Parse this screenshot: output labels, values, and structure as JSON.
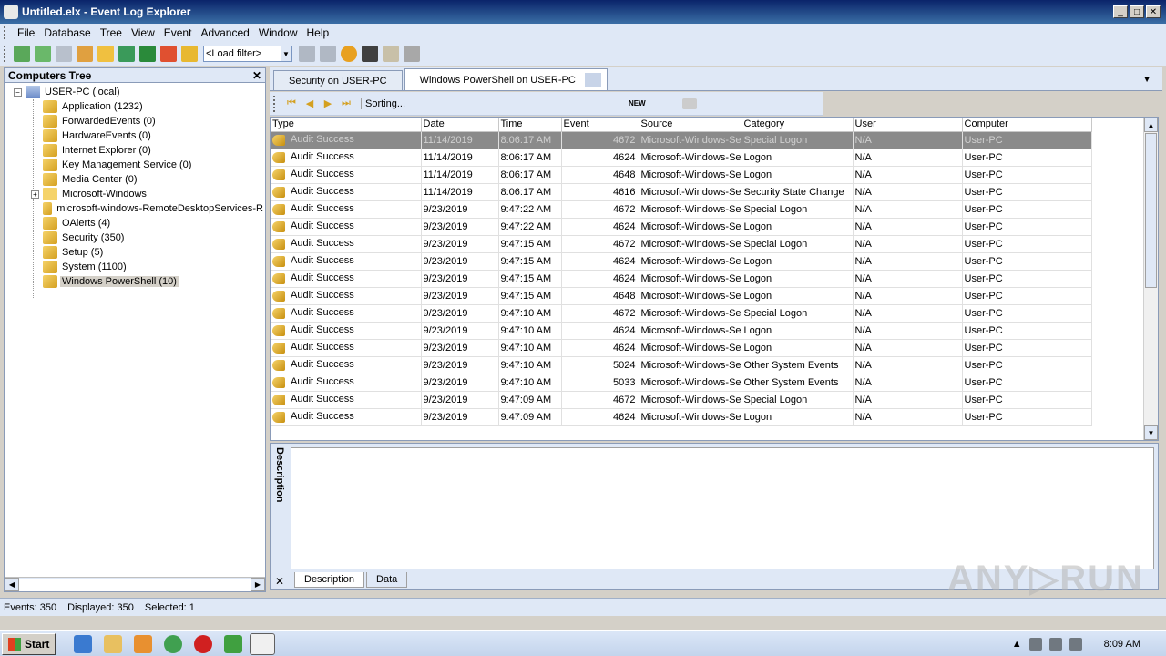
{
  "window": {
    "title": "Untitled.elx - Event Log Explorer",
    "minimize": "_",
    "maximize": "□",
    "close": "✕"
  },
  "menu": [
    "File",
    "Database",
    "Tree",
    "View",
    "Event",
    "Advanced",
    "Window",
    "Help"
  ],
  "toolbar": {
    "filter_value": "<Load filter>"
  },
  "computers_tree": {
    "title": "Computers Tree",
    "close": "✕",
    "root": "USER-PC (local)",
    "items": [
      "Application (1232)",
      "ForwardedEvents (0)",
      "HardwareEvents (0)",
      "Internet Explorer (0)",
      "Key Management Service (0)",
      "Media Center (0)",
      "Microsoft-Windows",
      "microsoft-windows-RemoteDesktopServices-R",
      "OAlerts (4)",
      "Security (350)",
      "Setup (5)",
      "System (1100)",
      "Windows PowerShell (10)"
    ]
  },
  "tabs": [
    "Security on USER-PC",
    "Windows PowerShell on USER-PC"
  ],
  "view_toolbar": {
    "sorting": "Sorting...",
    "new_label": "NEW"
  },
  "grid": {
    "columns": [
      "Type",
      "Date",
      "Time",
      "Event",
      "Source",
      "Category",
      "User",
      "Computer"
    ],
    "rows": [
      [
        "Audit Success",
        "11/14/2019",
        "8:06:17 AM",
        "4672",
        "Microsoft-Windows-Se",
        "Special Logon",
        "N/A",
        "User-PC"
      ],
      [
        "Audit Success",
        "11/14/2019",
        "8:06:17 AM",
        "4624",
        "Microsoft-Windows-Se",
        "Logon",
        "N/A",
        "User-PC"
      ],
      [
        "Audit Success",
        "11/14/2019",
        "8:06:17 AM",
        "4648",
        "Microsoft-Windows-Se",
        "Logon",
        "N/A",
        "User-PC"
      ],
      [
        "Audit Success",
        "11/14/2019",
        "8:06:17 AM",
        "4616",
        "Microsoft-Windows-Se",
        "Security State Change",
        "N/A",
        "User-PC"
      ],
      [
        "Audit Success",
        "9/23/2019",
        "9:47:22 AM",
        "4672",
        "Microsoft-Windows-Se",
        "Special Logon",
        "N/A",
        "User-PC"
      ],
      [
        "Audit Success",
        "9/23/2019",
        "9:47:22 AM",
        "4624",
        "Microsoft-Windows-Se",
        "Logon",
        "N/A",
        "User-PC"
      ],
      [
        "Audit Success",
        "9/23/2019",
        "9:47:15 AM",
        "4672",
        "Microsoft-Windows-Se",
        "Special Logon",
        "N/A",
        "User-PC"
      ],
      [
        "Audit Success",
        "9/23/2019",
        "9:47:15 AM",
        "4624",
        "Microsoft-Windows-Se",
        "Logon",
        "N/A",
        "User-PC"
      ],
      [
        "Audit Success",
        "9/23/2019",
        "9:47:15 AM",
        "4624",
        "Microsoft-Windows-Se",
        "Logon",
        "N/A",
        "User-PC"
      ],
      [
        "Audit Success",
        "9/23/2019",
        "9:47:15 AM",
        "4648",
        "Microsoft-Windows-Se",
        "Logon",
        "N/A",
        "User-PC"
      ],
      [
        "Audit Success",
        "9/23/2019",
        "9:47:10 AM",
        "4672",
        "Microsoft-Windows-Se",
        "Special Logon",
        "N/A",
        "User-PC"
      ],
      [
        "Audit Success",
        "9/23/2019",
        "9:47:10 AM",
        "4624",
        "Microsoft-Windows-Se",
        "Logon",
        "N/A",
        "User-PC"
      ],
      [
        "Audit Success",
        "9/23/2019",
        "9:47:10 AM",
        "4624",
        "Microsoft-Windows-Se",
        "Logon",
        "N/A",
        "User-PC"
      ],
      [
        "Audit Success",
        "9/23/2019",
        "9:47:10 AM",
        "5024",
        "Microsoft-Windows-Se",
        "Other System Events",
        "N/A",
        "User-PC"
      ],
      [
        "Audit Success",
        "9/23/2019",
        "9:47:10 AM",
        "5033",
        "Microsoft-Windows-Se",
        "Other System Events",
        "N/A",
        "User-PC"
      ],
      [
        "Audit Success",
        "9/23/2019",
        "9:47:09 AM",
        "4672",
        "Microsoft-Windows-Se",
        "Special Logon",
        "N/A",
        "User-PC"
      ],
      [
        "Audit Success",
        "9/23/2019",
        "9:47:09 AM",
        "4624",
        "Microsoft-Windows-Se",
        "Logon",
        "N/A",
        "User-PC"
      ]
    ]
  },
  "description_pane": {
    "title": "Description",
    "close": "✕",
    "tabs": [
      "Description",
      "Data"
    ]
  },
  "status": {
    "events": "Events: 350",
    "displayed": "Displayed: 350",
    "selected": "Selected: 1"
  },
  "watermark": "ANY▷RUN",
  "taskbar": {
    "start": "Start",
    "clock": "8:09 AM"
  }
}
